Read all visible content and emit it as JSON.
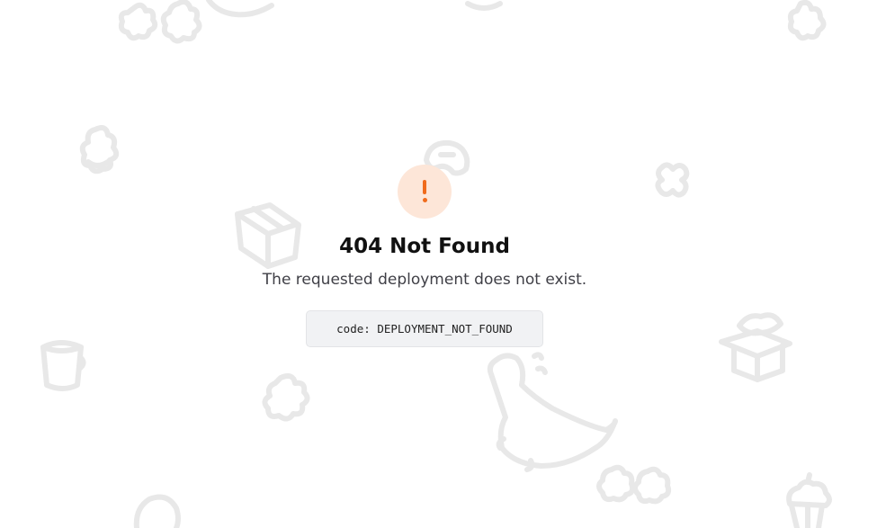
{
  "error": {
    "icon": "exclamation-icon",
    "accent_color": "#f06b1c",
    "icon_bg_color": "#fde6d8",
    "title": "404 Not Found",
    "message": "The requested deployment does not exist.",
    "code_prefix": "code: ",
    "code": "DEPLOYMENT_NOT_FOUND"
  },
  "background": {
    "doodle_color": "#e8e8e8"
  }
}
